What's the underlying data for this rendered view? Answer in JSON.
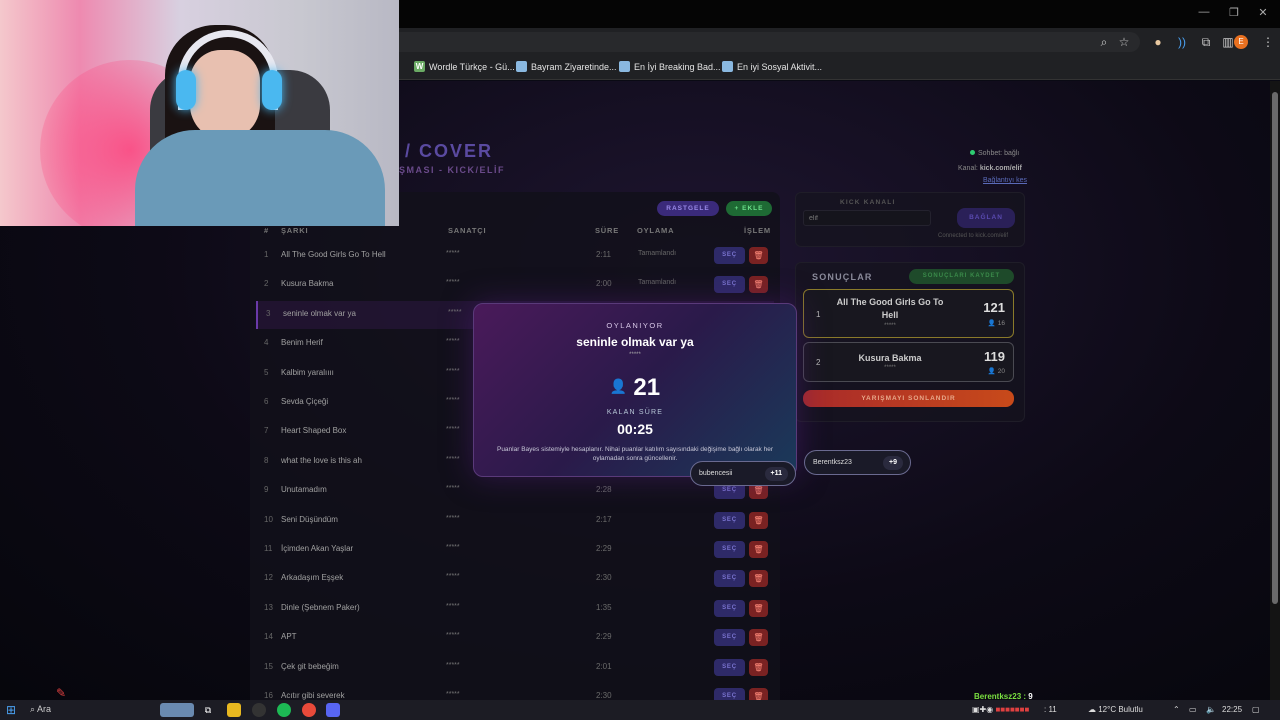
{
  "browser": {
    "window_controls": [
      "—",
      "❐",
      "✕"
    ],
    "bookmarks": [
      {
        "label": "Wordle Türkçe - Gü...",
        "icon": "W",
        "icon_color": "#6aaa64"
      },
      {
        "label": "Bayram Ziyaretinde...",
        "icon": "folder-image",
        "icon_color": "#8ab8e0"
      },
      {
        "label": "En İyi Breaking Bad...",
        "icon": "folder-image",
        "icon_color": "#8ab8e0"
      },
      {
        "label": "En iyi Sosyal Aktivit...",
        "icon": "folder-image",
        "icon_color": "#8ab8e0"
      }
    ],
    "profile_initial": "E"
  },
  "header": {
    "title": "/ COVER",
    "subtitle": "ŞMASI - KICK/ELİF",
    "status": "Sohbet: bağlı",
    "channel_label": "Kanal:",
    "channel_value": "kick.com/elif",
    "disconnect": "Bağlantıyı kes"
  },
  "toolbar": {
    "random_label": "RASTGELE",
    "add_label": "+ EKLE"
  },
  "table": {
    "headers": {
      "num": "#",
      "title": "ŞARKI",
      "artist": "SANATÇI",
      "duration": "SÜRE",
      "vote": "OYLAMA",
      "action": "İŞLEM"
    },
    "select_label": "SEÇ",
    "rows": [
      {
        "num": "1",
        "title": "All The Good Girls Go To Hell",
        "artist": "*****",
        "duration": "2:11",
        "vote": "Tamamlandı"
      },
      {
        "num": "2",
        "title": "Kusura Bakma",
        "artist": "*****",
        "duration": "2:00",
        "vote": "Tamamlandı"
      },
      {
        "num": "3",
        "title": "seninle olmak var ya",
        "artist": "*****",
        "duration": "",
        "vote": ""
      },
      {
        "num": "4",
        "title": "Benim Herif",
        "artist": "*****",
        "duration": "",
        "vote": ""
      },
      {
        "num": "5",
        "title": "Kalbim yaralıııı",
        "artist": "*****",
        "duration": "",
        "vote": ""
      },
      {
        "num": "6",
        "title": "Sevda Çiçeği",
        "artist": "*****",
        "duration": "",
        "vote": ""
      },
      {
        "num": "7",
        "title": "Heart Shaped Box",
        "artist": "*****",
        "duration": "",
        "vote": ""
      },
      {
        "num": "8",
        "title": "what the love is this ah",
        "artist": "*****",
        "duration": "",
        "vote": ""
      },
      {
        "num": "9",
        "title": "Unutamadım",
        "artist": "*****",
        "duration": "2:28",
        "vote": ""
      },
      {
        "num": "10",
        "title": "Seni Düşündüm",
        "artist": "*****",
        "duration": "2:17",
        "vote": ""
      },
      {
        "num": "11",
        "title": "İçimden Akan Yaşlar",
        "artist": "*****",
        "duration": "2:29",
        "vote": ""
      },
      {
        "num": "12",
        "title": "Arkadaşım Eşşek",
        "artist": "*****",
        "duration": "2:30",
        "vote": ""
      },
      {
        "num": "13",
        "title": "Dinle (Şebnem Paker)",
        "artist": "*****",
        "duration": "1:35",
        "vote": ""
      },
      {
        "num": "14",
        "title": "APT",
        "artist": "*****",
        "duration": "2:29",
        "vote": ""
      },
      {
        "num": "15",
        "title": "Çek git bebeğim",
        "artist": "*****",
        "duration": "2:01",
        "vote": ""
      },
      {
        "num": "16",
        "title": "Acıtır gibi severek",
        "artist": "*****",
        "duration": "2:30",
        "vote": ""
      }
    ]
  },
  "kick": {
    "label": "KICK KANALI",
    "input_value": "elif",
    "connect_label": "BAĞLAN",
    "connected_text": "Connected to kick.com/elif"
  },
  "results": {
    "title": "SONUÇLAR",
    "export_label": "SONUÇLARI KAYDET",
    "items": [
      {
        "rank": "1",
        "title": "All The Good Girls Go To Hell",
        "artist": "*****",
        "score": "121",
        "voters": "16"
      },
      {
        "rank": "2",
        "title": "Kusura Bakma",
        "artist": "*****",
        "score": "119",
        "voters": "20"
      }
    ],
    "end_label": "YARIŞMAYI SONLANDIR"
  },
  "modal": {
    "voting_label": "OYLANIYOR",
    "song": "seninle olmak var ya",
    "artist": "*****",
    "vote_count": "21",
    "remaining_label": "KALAN SÜRE",
    "time": "00:25",
    "note": "Puanlar Bayes sistemiyle hesaplanır. Nihai puanlar katılım sayısındaki değişime bağlı olarak her oylamadan sonra güncellenir."
  },
  "toasts": [
    {
      "name": "bubencesii",
      "points": "+11"
    },
    {
      "name": "Berentksz23",
      "points": "+9"
    }
  ],
  "chat_overlay": {
    "user": "Berentksz23 :",
    "value": " 9"
  },
  "taskbar": {
    "search": "Ara",
    "counter": ": 11",
    "weather": "12°C  Bulutlu",
    "time": "22:25"
  },
  "colors": {
    "accent": "#6a3aa8",
    "select_btn": "#2e2a68",
    "delete_btn": "#7a2222",
    "gold_border": "#8a7a2a"
  }
}
